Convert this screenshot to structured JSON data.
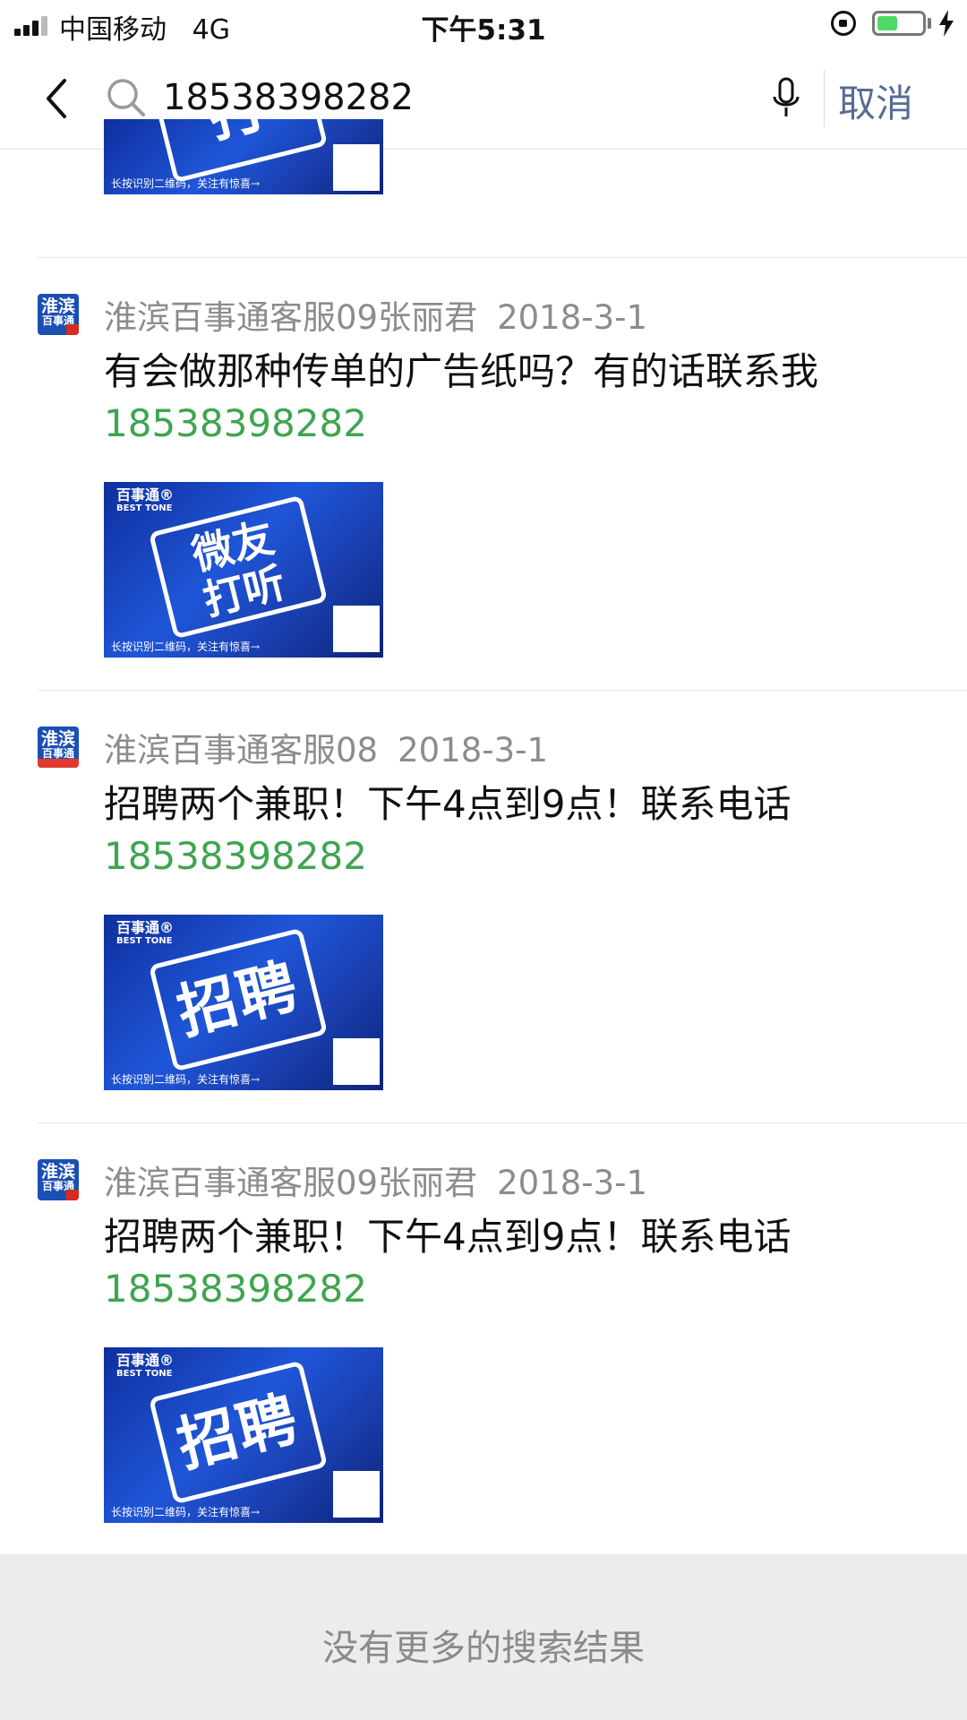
{
  "status_bar": {
    "carrier": "中国移动",
    "network": "4G",
    "time": "下午5:31",
    "battery_level": 0.45
  },
  "search": {
    "query": "18538398282",
    "cancel_label": "取消"
  },
  "results": [
    {
      "sender": "淮滨百事通客服09张丽君",
      "date": "2018-3-1",
      "message_prefix": "有会做那种传单的广告纸吗？有的话联系我",
      "phone": "18538398282",
      "avatar_text": "淮滨",
      "avatar_sub": "百事通",
      "thumb_brand": "百事通®",
      "thumb_brand_en": "BEST TONE",
      "thumb_stamp_lines": [
        "微友",
        "打听"
      ],
      "thumb_caption": "长按识别二维码，关注有惊喜→"
    },
    {
      "sender": "淮滨百事通客服08",
      "date": "2018-3-1",
      "message_prefix": "招聘两个兼职！下午4点到9点！联系电话",
      "phone": "18538398282",
      "avatar_text": "淮滨",
      "avatar_sub": "百事通",
      "thumb_brand": "百事通®",
      "thumb_brand_en": "BEST TONE",
      "thumb_stamp": "招聘",
      "thumb_caption": "长按识别二维码，关注有惊喜→"
    },
    {
      "sender": "淮滨百事通客服09张丽君",
      "date": "2018-3-1",
      "message_prefix": "招聘两个兼职！下午4点到9点！联系电话",
      "phone": "18538398282",
      "avatar_text": "淮滨",
      "avatar_sub": "百事通",
      "thumb_brand": "百事通®",
      "thumb_brand_en": "BEST TONE",
      "thumb_stamp": "招聘",
      "thumb_caption": "长按识别二维码，关注有惊喜→"
    }
  ],
  "top_partial_thumb_caption": "长按识别二维码，关注有惊喜→",
  "footer_text": "没有更多的搜索结果"
}
